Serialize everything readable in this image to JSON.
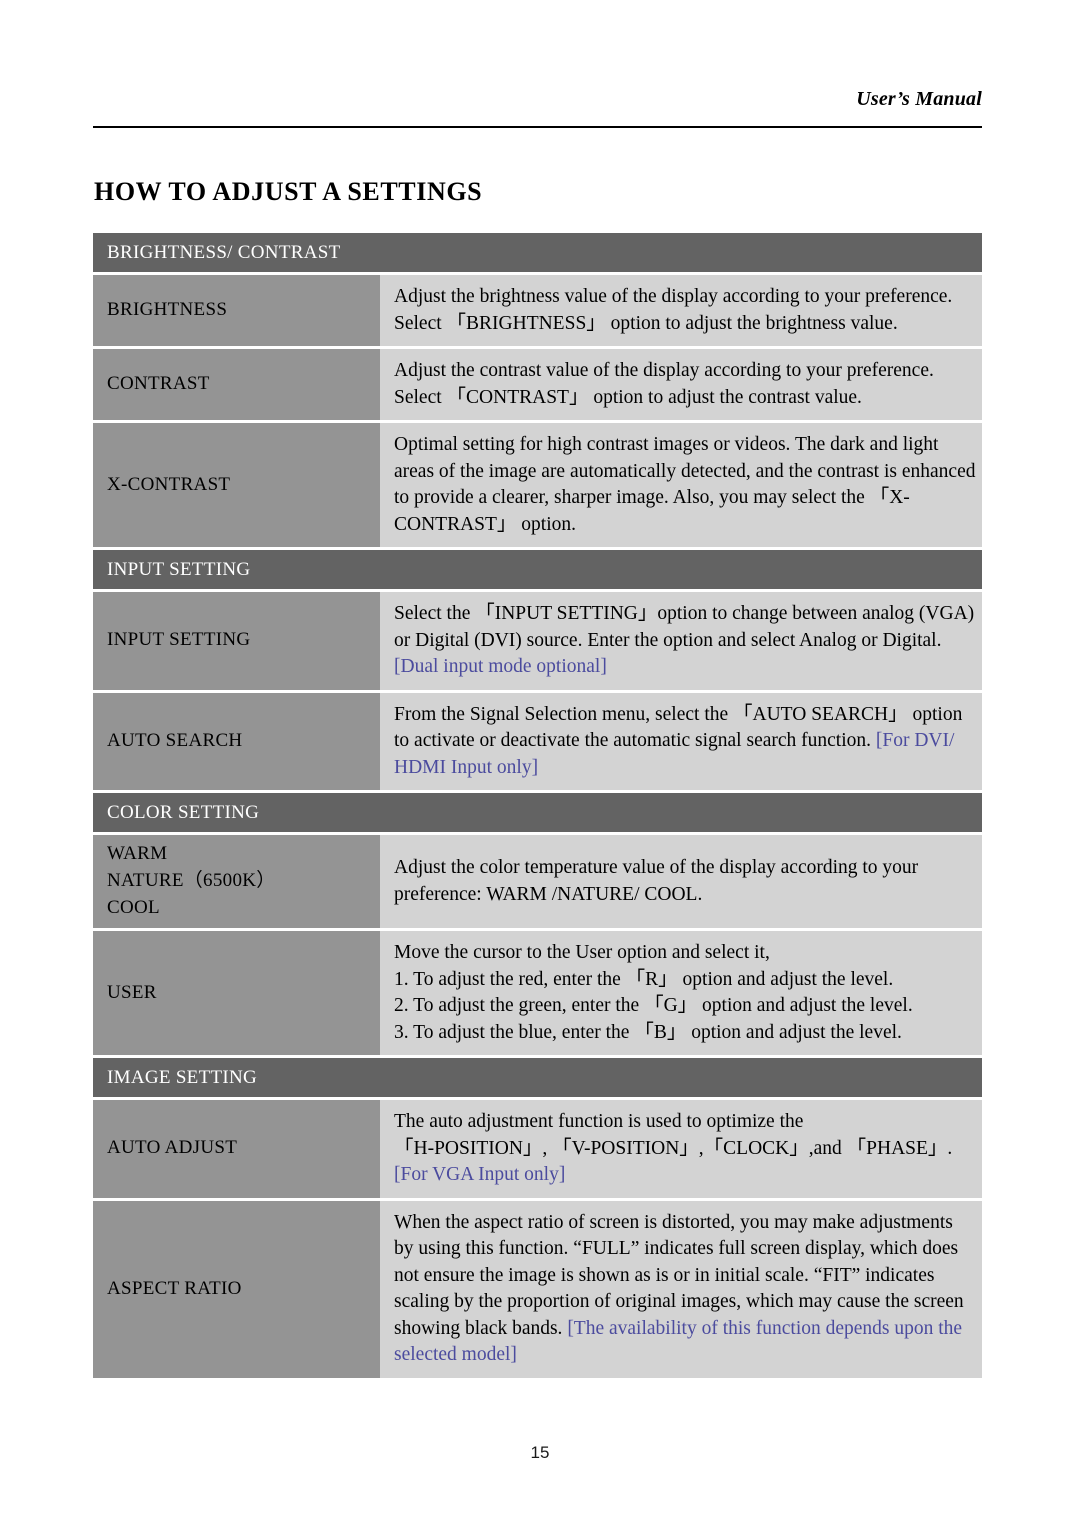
{
  "header": {
    "running_title": "User’s Manual",
    "page_title": "HOW TO ADJUST A SETTINGS"
  },
  "footer": {
    "page_number": "15"
  },
  "colors": {
    "section_header_bg": "#636363",
    "label_cell_bg": "#949494",
    "description_cell_bg": "#d3d3d3",
    "note_text": "#4b4b9e",
    "page_bg": "#ffffff",
    "body_text": "#000000",
    "section_header_text": "#ffffff"
  },
  "sections": [
    {
      "id": "brightness-contrast",
      "title": "BRIGHTNESS/ CONTRAST",
      "rows": [
        {
          "id": "brightness",
          "label_lines": [
            "BRIGHTNESS"
          ],
          "paragraphs": [
            "Adjust the brightness value of the display according to your preference. Select 「BRIGHTNESS」 option to adjust the brightness value."
          ]
        },
        {
          "id": "contrast",
          "label_lines": [
            "CONTRAST"
          ],
          "paragraphs": [
            "Adjust the contrast value of the display according to your preference. Select 「CONTRAST」 option to adjust the contrast value."
          ]
        },
        {
          "id": "x-contrast",
          "label_lines": [
            "X-CONTRAST"
          ],
          "paragraphs": [
            "Optimal setting for high contrast images or videos. The dark and light areas of the image are automatically detected, and the contrast is enhanced to provide a clearer, sharper image. Also, you may select the 「X-CONTRAST」 option."
          ]
        }
      ]
    },
    {
      "id": "input-setting",
      "title": "INPUT SETTING",
      "rows": [
        {
          "id": "input-setting-row",
          "label_lines": [
            "INPUT SETTING"
          ],
          "paragraphs": [
            "Select the 「INPUT SETTING」option to change between analog (VGA) or Digital (DVI) source. Enter the option and select Analog or Digital."
          ],
          "note": "[Dual input mode optional]"
        },
        {
          "id": "auto-search",
          "label_lines": [
            "AUTO SEARCH"
          ],
          "paragraphs": [
            "From the Signal Selection menu, select the 「AUTO SEARCH」 option to activate or deactivate the automatic signal search function."
          ],
          "note": "[For DVI/ HDMI Input only]"
        }
      ]
    },
    {
      "id": "color-setting",
      "title": "COLOR SETTING",
      "rows": [
        {
          "id": "warm-nature-cool",
          "label_lines": [
            "WARM",
            "NATURE（6500K）",
            "COOL"
          ],
          "paragraphs": [
            "Adjust the color temperature value of the display according to your preference: WARM /NATURE/ COOL."
          ]
        },
        {
          "id": "user",
          "label_lines": [
            "USER"
          ],
          "paragraphs": [
            "Move the cursor to the User option and select it,",
            "1. To adjust the red, enter the 「R」 option and adjust the level.",
            "2. To adjust the green, enter the 「G」 option and adjust the level.",
            "3. To adjust the blue, enter the 「B」 option and adjust the level."
          ]
        }
      ]
    },
    {
      "id": "image-setting",
      "title": "IMAGE SETTING",
      "rows": [
        {
          "id": "auto-adjust",
          "label_lines": [
            "AUTO ADJUST"
          ],
          "paragraphs": [
            "The auto adjustment function is used to optimize the",
            "「H-POSITION」, 「V-POSITION」,「CLOCK」,and 「PHASE」."
          ],
          "note": "[For VGA Input only]"
        },
        {
          "id": "aspect-ratio",
          "label_lines": [
            "ASPECT RATIO"
          ],
          "paragraphs": [
            "When the aspect ratio of screen is distorted, you may make adjustments by using this function. “FULL” indicates full screen display, which does not ensure the image is shown as is or in initial scale. “FIT” indicates scaling by the proportion of original images, which may cause the screen showing black bands."
          ],
          "note": "[The availability of this function depends upon the selected model]"
        }
      ]
    }
  ]
}
